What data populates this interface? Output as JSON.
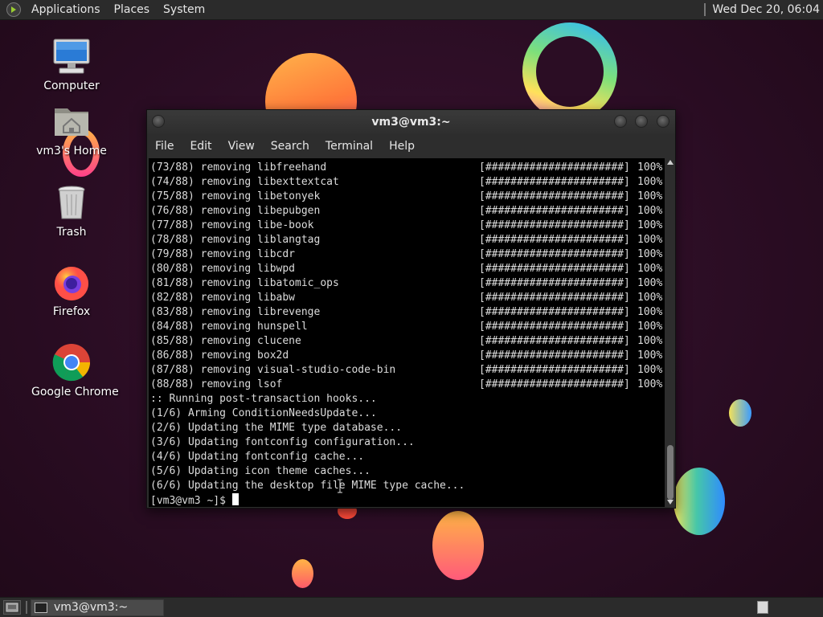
{
  "top_panel": {
    "menus": [
      "Applications",
      "Places",
      "System"
    ],
    "clock": "Wed Dec 20, 06:04"
  },
  "desktop_icons": [
    {
      "label": "Computer",
      "icon": "computer-icon"
    },
    {
      "label": "vm3's Home",
      "icon": "home-folder-icon"
    },
    {
      "label": "Trash",
      "icon": "trash-icon"
    },
    {
      "label": "Firefox",
      "icon": "firefox-icon"
    },
    {
      "label": "Google Chrome",
      "icon": "chrome-icon"
    }
  ],
  "terminal": {
    "title": "vm3@vm3:~",
    "menubar": [
      "File",
      "Edit",
      "View",
      "Search",
      "Terminal",
      "Help"
    ],
    "removals": [
      {
        "step": "(73/88)",
        "action": "removing",
        "package": "libfreehand"
      },
      {
        "step": "(74/88)",
        "action": "removing",
        "package": "libexttextcat"
      },
      {
        "step": "(75/88)",
        "action": "removing",
        "package": "libetonyek"
      },
      {
        "step": "(76/88)",
        "action": "removing",
        "package": "libepubgen"
      },
      {
        "step": "(77/88)",
        "action": "removing",
        "package": "libe-book"
      },
      {
        "step": "(78/88)",
        "action": "removing",
        "package": "liblangtag"
      },
      {
        "step": "(79/88)",
        "action": "removing",
        "package": "libcdr"
      },
      {
        "step": "(80/88)",
        "action": "removing",
        "package": "libwpd"
      },
      {
        "step": "(81/88)",
        "action": "removing",
        "package": "libatomic_ops"
      },
      {
        "step": "(82/88)",
        "action": "removing",
        "package": "libabw"
      },
      {
        "step": "(83/88)",
        "action": "removing",
        "package": "librevenge"
      },
      {
        "step": "(84/88)",
        "action": "removing",
        "package": "hunspell"
      },
      {
        "step": "(85/88)",
        "action": "removing",
        "package": "clucene"
      },
      {
        "step": "(86/88)",
        "action": "removing",
        "package": "box2d"
      },
      {
        "step": "(87/88)",
        "action": "removing",
        "package": "visual-studio-code-bin"
      },
      {
        "step": "(88/88)",
        "action": "removing",
        "package": "lsof"
      }
    ],
    "progress_bar": "[######################]",
    "progress_pct": "100%",
    "hook_lines": [
      ":: Running post-transaction hooks...",
      "(1/6) Arming ConditionNeedsUpdate...",
      "(2/6) Updating the MIME type database...",
      "(3/6) Updating fontconfig configuration...",
      "(4/6) Updating fontconfig cache...",
      "(5/6) Updating icon theme caches...",
      "(6/6) Updating the desktop file MIME type cache..."
    ],
    "prompt": "[vm3@vm3 ~]$ "
  },
  "bottom_panel": {
    "task_label": "vm3@vm3:~"
  },
  "colors": {
    "panel_bg": "#2b2b2b",
    "terminal_bg": "#000000",
    "terminal_fg": "#dcdcdc",
    "desktop_bg": "#2b0d24"
  }
}
